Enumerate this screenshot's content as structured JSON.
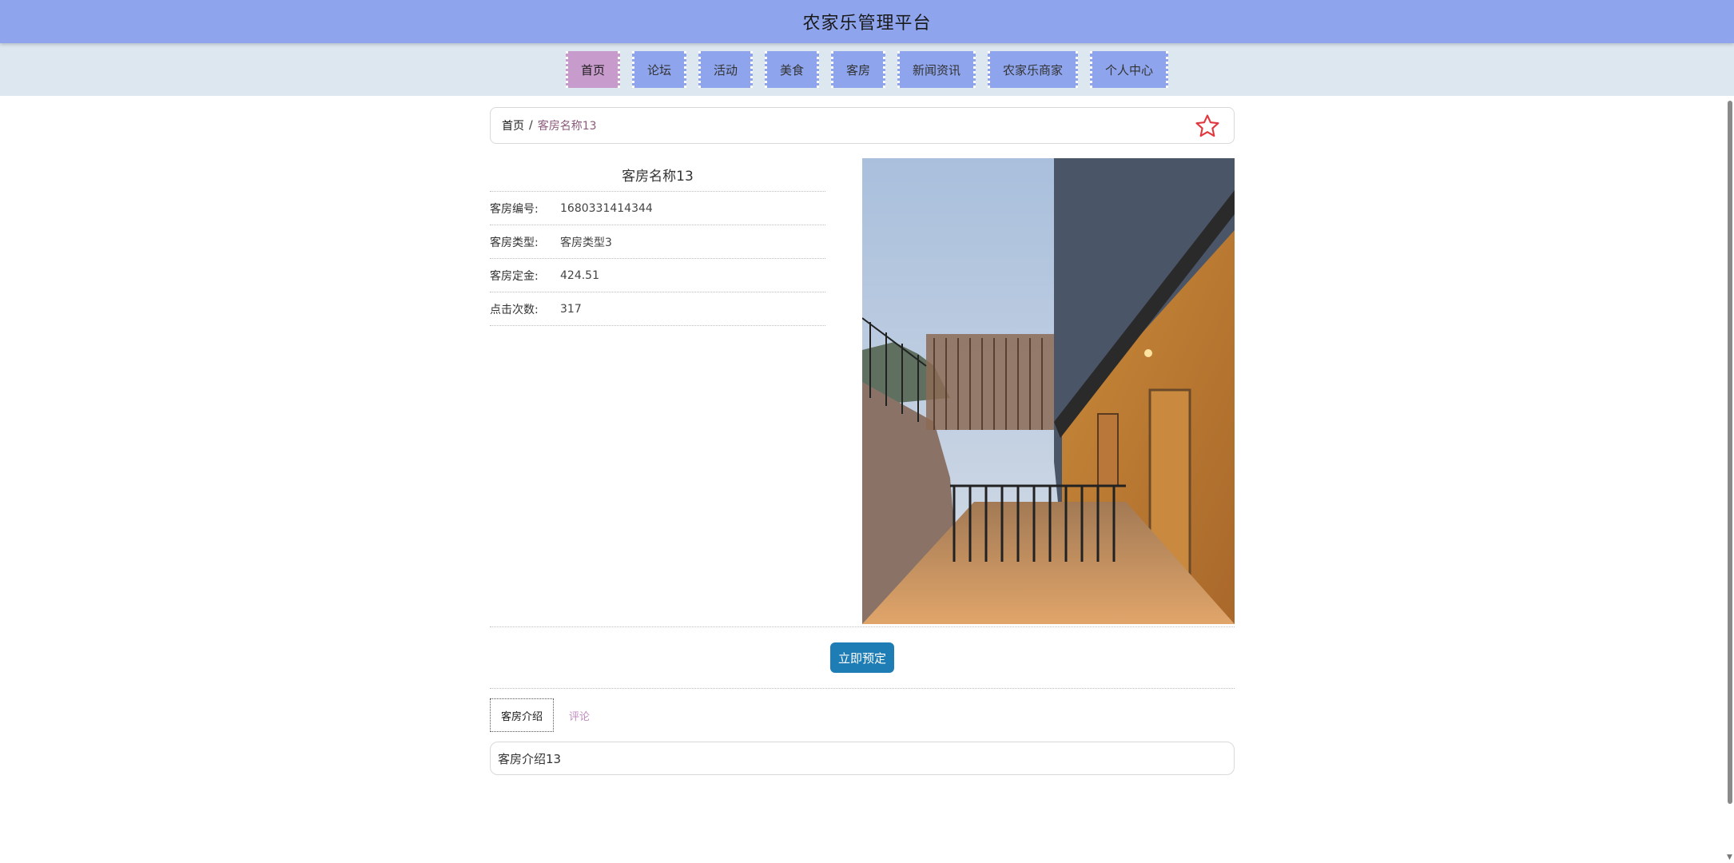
{
  "header": {
    "title": "农家乐管理平台"
  },
  "nav": {
    "items": [
      {
        "label": "首页",
        "active": true
      },
      {
        "label": "论坛",
        "active": false
      },
      {
        "label": "活动",
        "active": false
      },
      {
        "label": "美食",
        "active": false
      },
      {
        "label": "客房",
        "active": false
      },
      {
        "label": "新闻资讯",
        "active": false
      },
      {
        "label": "农家乐商家",
        "active": false
      },
      {
        "label": "个人中心",
        "active": false
      }
    ]
  },
  "breadcrumb": {
    "home": "首页",
    "separator": "/",
    "current": "客房名称13"
  },
  "room": {
    "name": "客房名称13",
    "fields": [
      {
        "label": "客房编号:",
        "value": "1680331414344"
      },
      {
        "label": "客房类型:",
        "value": "客房类型3"
      },
      {
        "label": "客房定金:",
        "value": "424.51"
      },
      {
        "label": "点击次数:",
        "value": "317"
      }
    ]
  },
  "actions": {
    "book_label": "立即预定"
  },
  "tabs": [
    {
      "label": "客房介绍",
      "active": true
    },
    {
      "label": "评论",
      "active": false
    }
  ],
  "tab_content": {
    "text": "客房介绍13"
  },
  "colors": {
    "header_bg": "#8ea4ec",
    "nav_bg": "#dce7ef",
    "nav_active": "#c79ccc",
    "button": "#1f7db6",
    "star": "#e0383e"
  },
  "icons": {
    "favorite": "star-outline-icon"
  }
}
